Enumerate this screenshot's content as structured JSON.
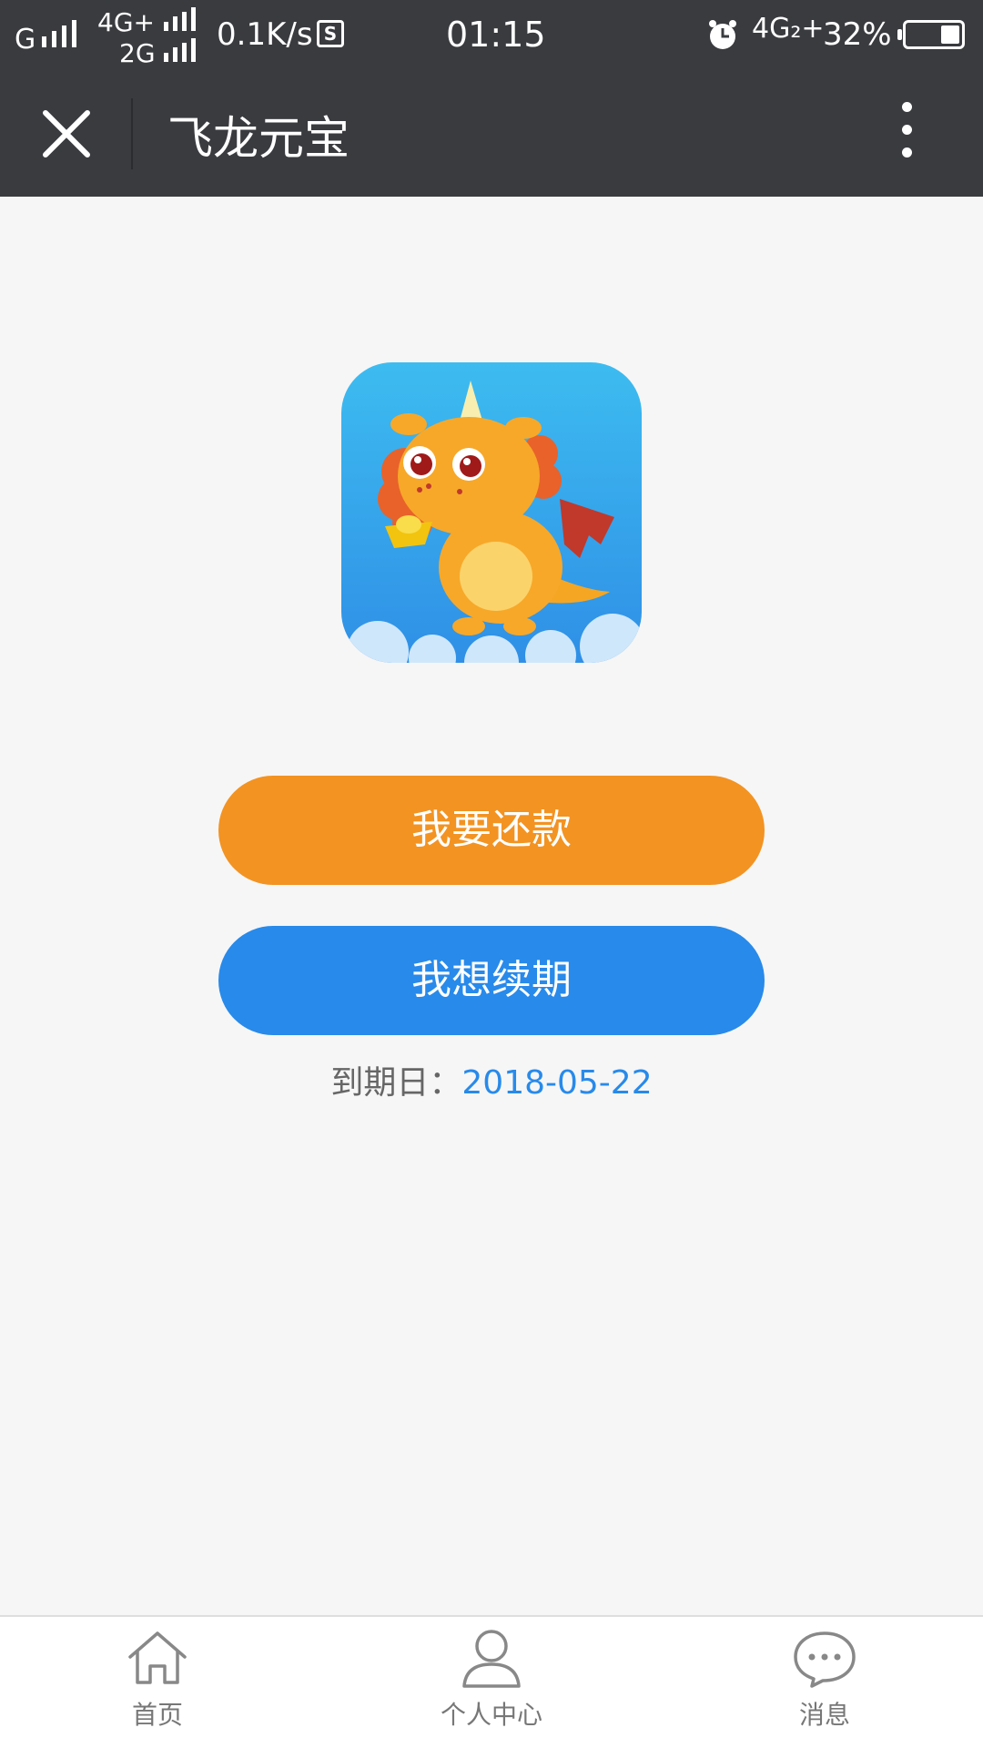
{
  "status_bar": {
    "carrier1": "G",
    "carrier2_top": "4G+",
    "carrier2_bottom": "2G",
    "net_speed": "0.1K/s",
    "s_icon": "S",
    "time": "01:15",
    "network_type": "4G₂+",
    "battery_percent": "32%",
    "battery_level": 0.32
  },
  "nav": {
    "title": "飞龙元宝",
    "close_icon": "close-icon",
    "more_icon": "more-vertical-icon"
  },
  "main": {
    "logo_icon": "dragon-logo",
    "repay_button": "我要还款",
    "renew_button": "我想续期",
    "due_label": "到期日：",
    "due_date": "2018-05-22"
  },
  "tab_bar": {
    "items": [
      {
        "label": "首页",
        "icon": "home-icon"
      },
      {
        "label": "个人中心",
        "icon": "user-icon"
      },
      {
        "label": "消息",
        "icon": "message-icon"
      }
    ]
  },
  "colors": {
    "header_bg": "#3a3b3f",
    "page_bg": "#f6f6f6",
    "repay_orange": "#f39322",
    "renew_blue": "#288aea",
    "due_date_blue": "#288aea"
  }
}
